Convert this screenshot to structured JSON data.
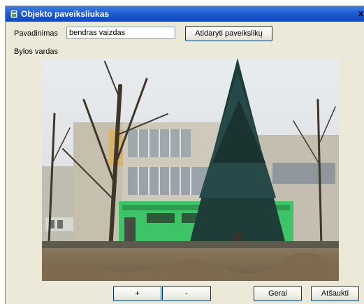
{
  "window": {
    "title": "Objekto paveiksliukas",
    "close_glyph": "x"
  },
  "form": {
    "name_label": "Pavadinimas",
    "name_value": "bendras vaizdas",
    "open_image_button": "Atidaryti paveikslikų",
    "file_name_label": "Bylos vardas"
  },
  "image": {
    "description": "photo"
  },
  "buttons": {
    "add": "+",
    "remove": "-",
    "ok": "Gerai",
    "cancel": "Atšaukti"
  },
  "colors": {
    "titlebar": "#0f47bf",
    "window_bg": "#ece9d8",
    "building_green": "#3cc466"
  }
}
